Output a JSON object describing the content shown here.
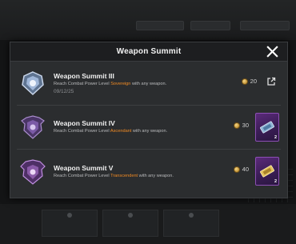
{
  "modal": {
    "title": "Weapon Summit"
  },
  "achievements": [
    {
      "title": "Weapon Summit III",
      "desc_prefix": "Reach Combat Power Level ",
      "level": "Sovereign",
      "desc_suffix": " with any weapon.",
      "date": "09/12/25",
      "reward": "20",
      "badge_color": "#9fb6d8"
    },
    {
      "title": "Weapon Summit IV",
      "desc_prefix": "Reach Combat Power Level ",
      "level": "Ascendant",
      "desc_suffix": " with any weapon.",
      "reward": "30",
      "item_qty": "2",
      "item_icon": "blue-ticket-icon",
      "badge_color": "#7b5aa6"
    },
    {
      "title": "Weapon Summit V",
      "desc_prefix": "Reach Combat Power Level ",
      "level": "Transcendent",
      "desc_suffix": " with any weapon.",
      "reward": "40",
      "item_qty": "2",
      "item_icon": "gold-ticket-icon",
      "badge_color": "#8a5aa8"
    }
  ],
  "colors": {
    "highlight": "#f08a24",
    "item_card": "#5b2a7a"
  }
}
